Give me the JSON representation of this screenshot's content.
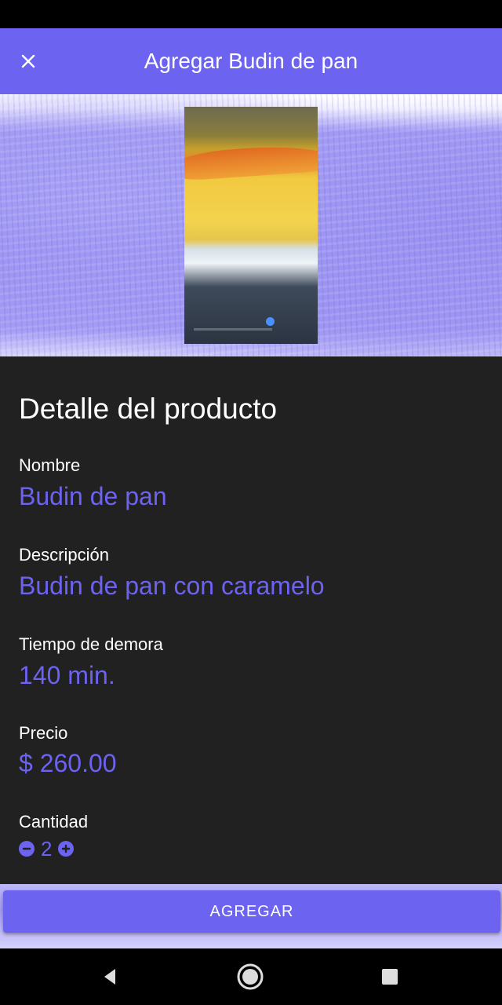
{
  "app_bar": {
    "title": "Agregar Budin de pan",
    "close_icon": "close-icon",
    "background_color": "#6c63f0"
  },
  "detail": {
    "section_title": "Detalle del producto",
    "name": {
      "label": "Nombre",
      "value": "Budin de pan"
    },
    "description": {
      "label": "Descripción",
      "value": "Budin de pan con caramelo"
    },
    "delay": {
      "label": "Tiempo de demora",
      "value": "140 min."
    },
    "price": {
      "label": "Precio",
      "value": "$ 260.00"
    },
    "quantity": {
      "label": "Cantidad",
      "value": "2",
      "decrement_icon": "minus-circle-icon",
      "increment_icon": "plus-circle-icon"
    }
  },
  "add_button": {
    "label": "AGREGAR"
  },
  "nav": {
    "back_icon": "back-icon",
    "home_icon": "home-icon",
    "recents_icon": "recents-icon"
  },
  "colors": {
    "accent": "#6c63f0",
    "background": "#212121"
  }
}
